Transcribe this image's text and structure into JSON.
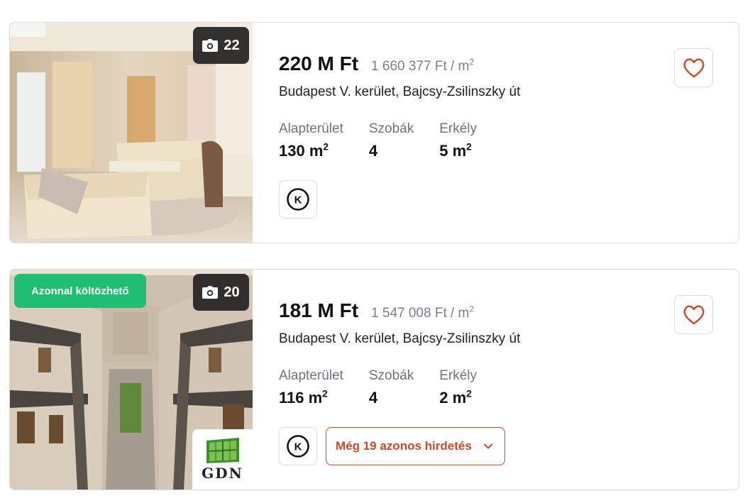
{
  "listings": [
    {
      "photo_count": "22",
      "price": "220 M Ft",
      "price_per_sqm": "1 660 377 Ft / m",
      "price_per_sqm_exp": "2",
      "address": "Budapest V. kerület, Bajcsy-Zsilinszky út",
      "params": [
        {
          "label": "Alapterület",
          "value": "130 m",
          "exp": "2"
        },
        {
          "label": "Szobák",
          "value": "4",
          "exp": ""
        },
        {
          "label": "Erkély",
          "value": "5 m",
          "exp": "2"
        }
      ],
      "credit_icon_letter": "K",
      "icons": {
        "camera": "camera-icon",
        "favorite": "heart-icon",
        "credit": "k-circle-icon"
      }
    },
    {
      "photo_count": "20",
      "badge": "Azonnal költözhető",
      "agency_logo_text": "GDN",
      "price": "181 M Ft",
      "price_per_sqm": "1 547 008 Ft / m",
      "price_per_sqm_exp": "2",
      "address": "Budapest V. kerület, Bajcsy-Zsilinszky út",
      "params": [
        {
          "label": "Alapterület",
          "value": "116 m",
          "exp": "2"
        },
        {
          "label": "Szobák",
          "value": "4",
          "exp": ""
        },
        {
          "label": "Erkély",
          "value": "2 m",
          "exp": "2"
        }
      ],
      "credit_icon_letter": "K",
      "more_button": "Még 19 azonos hirdetés",
      "icons": {
        "camera": "camera-icon",
        "favorite": "heart-icon",
        "credit": "k-circle-icon",
        "more": "chevron-down-icon"
      }
    }
  ],
  "colors": {
    "accent": "#cf4727",
    "badge_green": "#1fbe72",
    "border": "#d8dadd",
    "muted_text": "#7b8087"
  }
}
